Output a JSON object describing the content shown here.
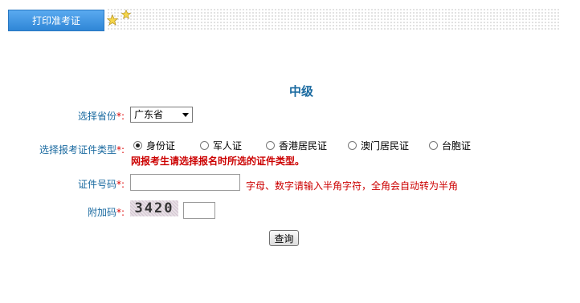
{
  "tab": {
    "label": "打印准考证"
  },
  "form": {
    "title": "中级",
    "required_mark": "*:",
    "province": {
      "label": "选择省份",
      "selected": "广东省"
    },
    "cert_type": {
      "label": "选择报考证件类型",
      "options": [
        "身份证",
        "军人证",
        "香港居民证",
        "澳门居民证",
        "台胞证"
      ],
      "selected_index": 0,
      "warning": "网报考生请选择报名时所选的证件类型。"
    },
    "cert_number": {
      "label": "证件号码",
      "value": "",
      "hint": "字母、数字请输入半角字符，全角会自动转为半角"
    },
    "captcha": {
      "label": "附加码",
      "image_text": "3420",
      "value": ""
    },
    "submit": {
      "label": "查询"
    }
  }
}
